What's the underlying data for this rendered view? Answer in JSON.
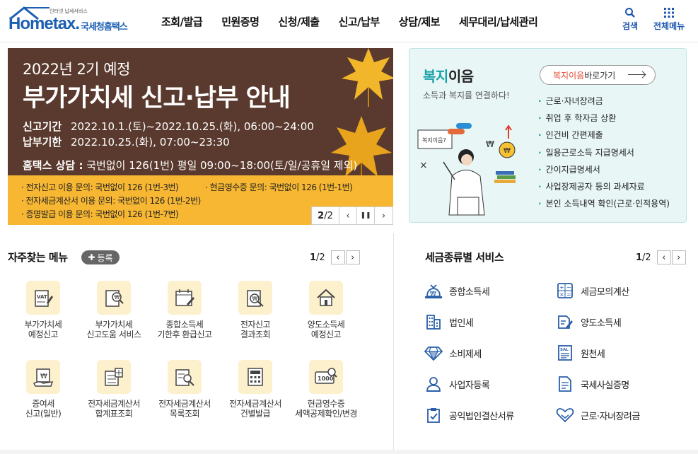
{
  "header": {
    "logo_tiny": "인터넷 납세서비스",
    "logo_word_a": "Hom",
    "logo_word_e": "e",
    "logo_word_b": "tax.",
    "logo_korean": "국세청홈택스",
    "nav": [
      "조회/발급",
      "민원증명",
      "신청/제출",
      "신고/납부",
      "상담/제보",
      "세무대리/납세관리"
    ],
    "search_label": "검색",
    "menu_label": "전체메뉴"
  },
  "banner": {
    "line1": "2022년 2기 예정",
    "title": "부가가치세 신고·납부 안내",
    "period_label": "신고기간",
    "period_value": "2022.10.1.(토)~2022.10.25.(화), 06:00~24:00",
    "deadline_label": "납부기한",
    "deadline_value": "2022.10.25.(화), 07:00~23:30",
    "consult_label": "홈택스 상담 :",
    "consult_value": "국번없이 126(1번)  평일 09:00~18:00(토/일/공휴일 제외)",
    "info": [
      "· 전자신고 이용 문의: 국번없이 126 (1번-3번)",
      "· 현금영수증 문의: 국번없이 126 (1번-1번)",
      "· 전자세금계산서 이용 문의: 국번없이 126 (1번-2번)",
      "· 증명발급 이용 문의: 국번없이 126 (1번-7번)"
    ],
    "pager_current": "2",
    "pager_total": "/2",
    "prev": "‹",
    "pause": "❚❚",
    "next": "›"
  },
  "bokji": {
    "title_hl": "복지",
    "title_rest": "이음",
    "subtitle": "소득과 복지를 연결하다!",
    "btn_hl": "복지이음",
    "btn_rest": " 바로가기",
    "bubble": "복지이음?",
    "items": [
      "근로·자녀장려금",
      "취업 후 학자금 상환",
      "인건비 간편제출",
      "일용근로소득 지급명세서",
      "간이지급명세서",
      "사업장제공자 등의 과세자료",
      "본인 소득내역 확인(근로·인적용역)"
    ]
  },
  "favorites": {
    "title": "자주찾는 메뉴",
    "register": "등록",
    "page_current": "1",
    "page_total": "/2",
    "prev": "‹",
    "next": "›",
    "items": [
      {
        "label": "부가가치세\n예정신고",
        "icon": "vat-document-icon"
      },
      {
        "label": "부가가치세\n신고도움 서비스",
        "icon": "won-search-icon"
      },
      {
        "label": "종합소득세\n기한후 환급신고",
        "icon": "calendar-pen-icon"
      },
      {
        "label": "전자신고\n결과조회",
        "icon": "won-search-icon"
      },
      {
        "label": "양도소득세\n예정신고",
        "icon": "house-icon"
      },
      {
        "label": "증여세\n신고(일반)",
        "icon": "gift-won-icon"
      },
      {
        "label": "전자세금계산서\n합계표조회",
        "icon": "calculator-sheet-icon"
      },
      {
        "label": "전자세금계산서\n목록조회",
        "icon": "list-search-icon"
      },
      {
        "label": "전자세금계산서\n건별발급",
        "icon": "calculator-icon"
      },
      {
        "label": "현금영수증\n세액공제확인/변경",
        "icon": "cash-search-icon"
      }
    ]
  },
  "tax_services": {
    "title": "세금종류별 서비스",
    "page_current": "1",
    "page_total": "/2",
    "prev": "‹",
    "next": "›",
    "items": [
      {
        "label": "종합소득세",
        "icon": "money-bag-icon"
      },
      {
        "label": "세금모의계산",
        "icon": "calculator-icon"
      },
      {
        "label": "법인세",
        "icon": "building-icon"
      },
      {
        "label": "양도소득세",
        "icon": "document-pen-icon"
      },
      {
        "label": "소비제세",
        "icon": "diamond-icon"
      },
      {
        "label": "원천세",
        "icon": "salary-document-icon"
      },
      {
        "label": "사업자등록",
        "icon": "person-icon"
      },
      {
        "label": "국세사실증명",
        "icon": "certificate-icon"
      },
      {
        "label": "공익법인결산서류",
        "icon": "clipboard-check-icon"
      },
      {
        "label": "근로·자녀장려금",
        "icon": "heart-hands-icon"
      }
    ]
  },
  "colors": {
    "brand": "#1b5fb2",
    "banner_bg": "#5a3a2e",
    "banner_band": "#f7b733",
    "bokji_accent": "#1aa3a8",
    "icon_bg": "#fdf0cc",
    "service_icon": "#2a5fa8"
  }
}
